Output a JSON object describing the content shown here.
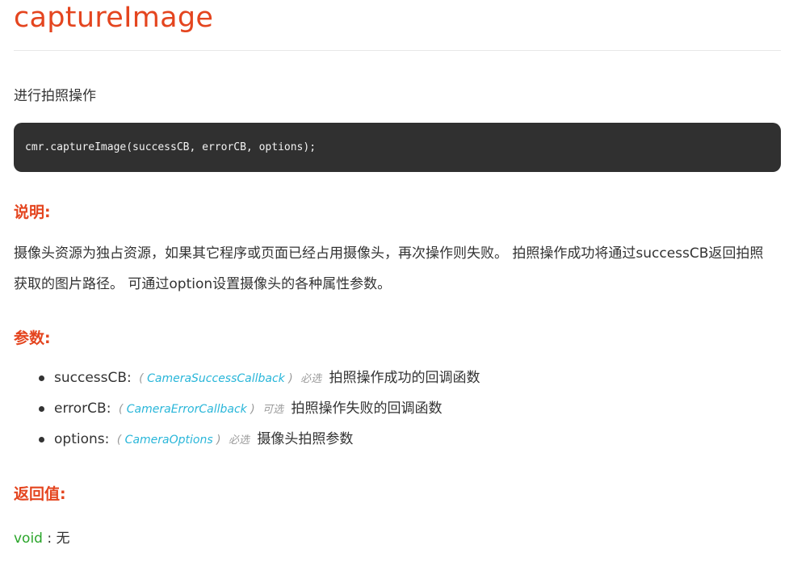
{
  "title": "captureImage",
  "description": "进行拍照操作",
  "code": "cmr.captureImage(successCB, errorCB, options);",
  "explanation": {
    "heading": "说明:",
    "text": "摄像头资源为独占资源，如果其它程序或页面已经占用摄像头，再次操作则失败。 拍照操作成功将通过successCB返回拍照获取的图片路径。 可通过option设置摄像头的各种属性参数。"
  },
  "params": {
    "heading": "参数:",
    "items": [
      {
        "name": "successCB:",
        "type": "CameraSuccessCallback",
        "optional": "必选",
        "desc": "拍照操作成功的回调函数"
      },
      {
        "name": "errorCB:",
        "type": "CameraErrorCallback",
        "optional": "可选",
        "desc": "拍照操作失败的回调函数"
      },
      {
        "name": "options:",
        "type": "CameraOptions",
        "optional": "必选",
        "desc": "摄像头拍照参数"
      }
    ]
  },
  "returns": {
    "heading": "返回值:",
    "type": "void",
    "sep": " : ",
    "value": "无"
  },
  "colors": {
    "heading": "#e4451f",
    "type_link": "#29b6d9",
    "return_type": "#2aa52a",
    "code_bg": "#303030"
  }
}
